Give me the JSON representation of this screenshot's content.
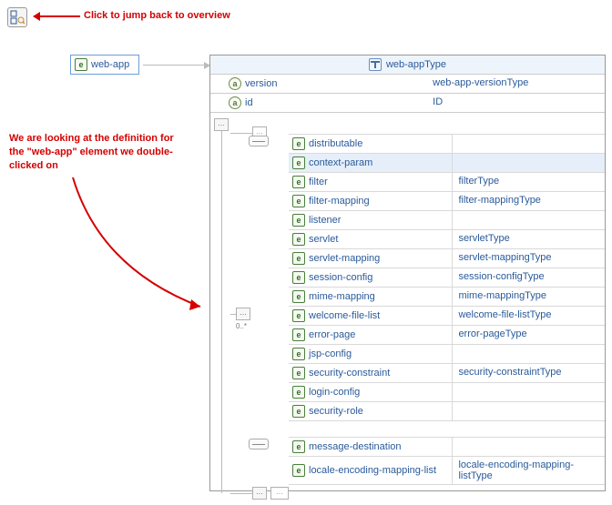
{
  "annotations": {
    "top": "Click to jump back to overview",
    "left": "We are looking at the definition for the \"web-app\" element we double-clicked on"
  },
  "root_element": "web-app",
  "type_header": "web-appType",
  "attributes": [
    {
      "name": "version",
      "type": "web-app-versionType"
    },
    {
      "name": "id",
      "type": "ID"
    }
  ],
  "middle_container_cardinality": "0..*",
  "groups": [
    {
      "items": [
        {
          "name": "distributable",
          "type": ""
        },
        {
          "name": "context-param",
          "type": "",
          "selected": true
        },
        {
          "name": "filter",
          "type": "filterType"
        },
        {
          "name": "filter-mapping",
          "type": "filter-mappingType"
        },
        {
          "name": "listener",
          "type": ""
        },
        {
          "name": "servlet",
          "type": "servletType"
        },
        {
          "name": "servlet-mapping",
          "type": "servlet-mappingType"
        },
        {
          "name": "session-config",
          "type": "session-configType"
        },
        {
          "name": "mime-mapping",
          "type": "mime-mappingType"
        },
        {
          "name": "welcome-file-list",
          "type": "welcome-file-listType"
        },
        {
          "name": "error-page",
          "type": "error-pageType"
        },
        {
          "name": "jsp-config",
          "type": ""
        },
        {
          "name": "security-constraint",
          "type": "security-constraintType"
        },
        {
          "name": "login-config",
          "type": ""
        },
        {
          "name": "security-role",
          "type": ""
        }
      ]
    },
    {
      "items": [
        {
          "name": "message-destination",
          "type": ""
        },
        {
          "name": "locale-encoding-mapping-list",
          "type": "locale-encoding-mapping-listType"
        }
      ]
    }
  ]
}
